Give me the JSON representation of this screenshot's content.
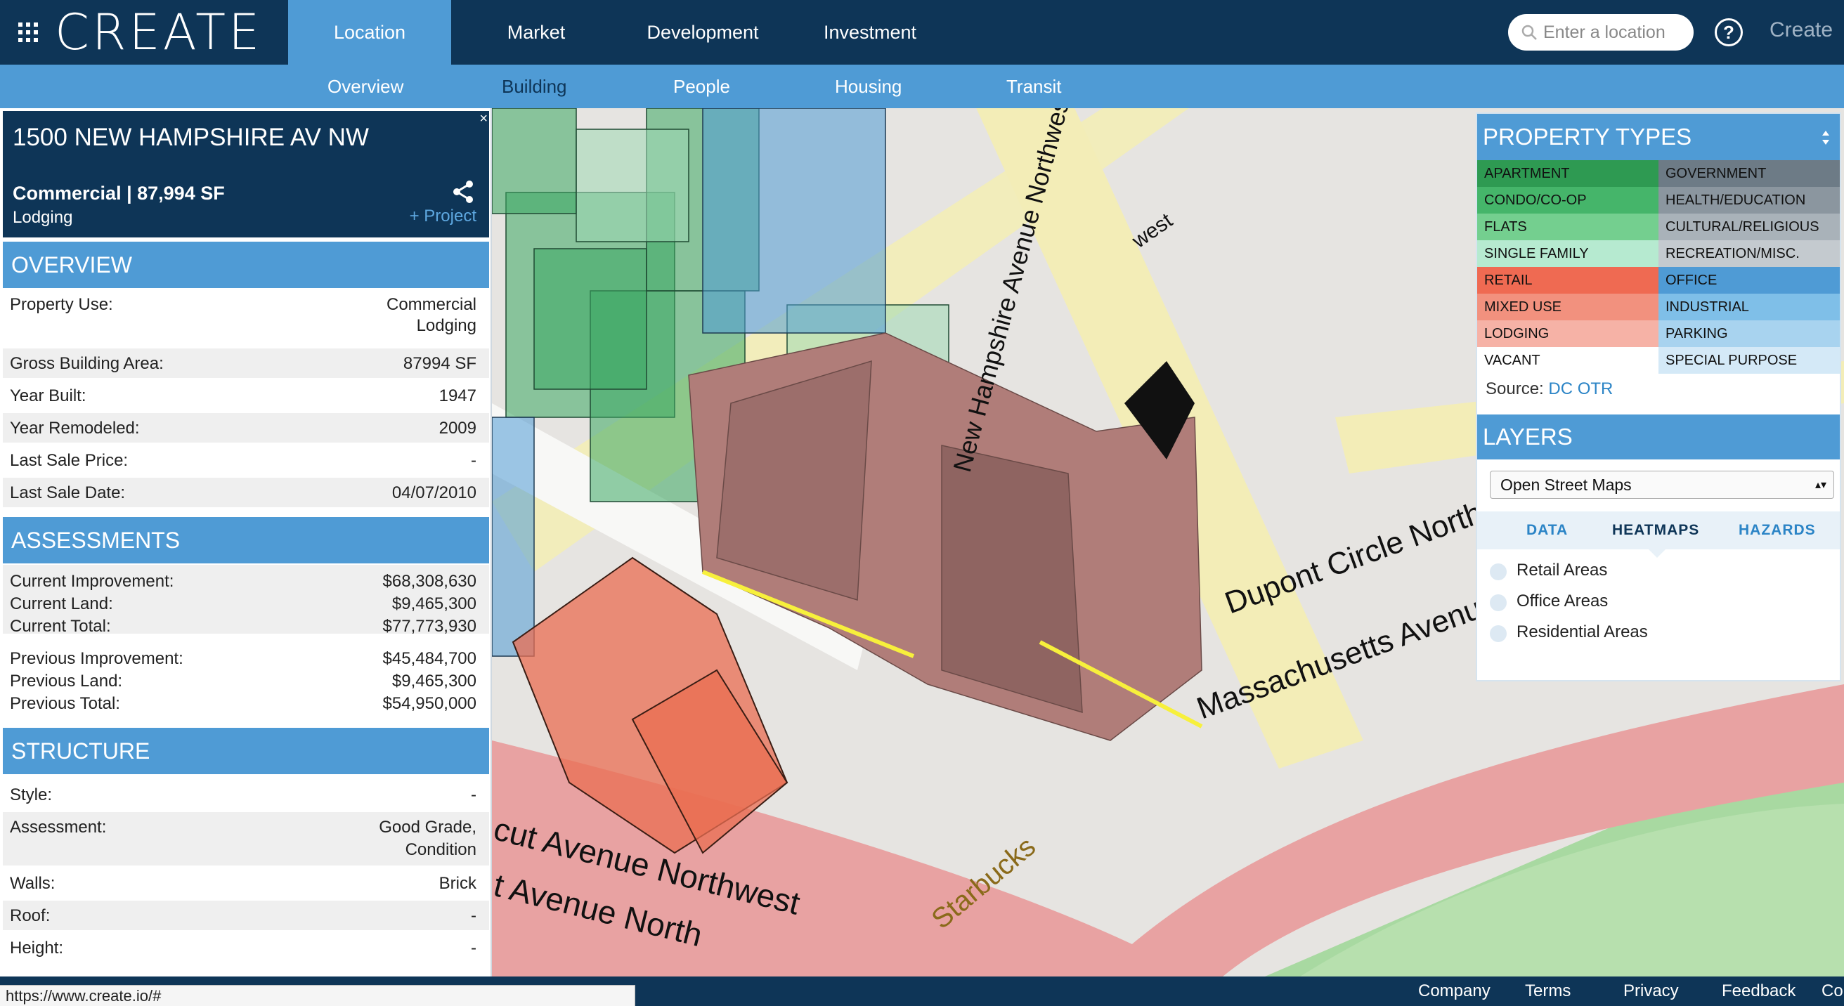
{
  "brand": {
    "name": "CREATE"
  },
  "nav": {
    "tabs": [
      {
        "label": "Location"
      },
      {
        "label": "Market"
      },
      {
        "label": "Development"
      },
      {
        "label": "Investment"
      }
    ],
    "search_placeholder": "Enter a location",
    "help": "?",
    "create": "Create"
  },
  "subnav": {
    "tabs": [
      {
        "label": "Overview"
      },
      {
        "label": "Building"
      },
      {
        "label": "People"
      },
      {
        "label": "Housing"
      },
      {
        "label": "Transit"
      }
    ]
  },
  "property": {
    "address": "1500 NEW HAMPSHIRE AV NW",
    "type_line": "Commercial | 87,994 SF",
    "subtype": "Lodging",
    "project_link": "+ Project",
    "close": "×"
  },
  "overview": {
    "title": "OVERVIEW",
    "rows": [
      {
        "label": "Property Use:",
        "value": "Commercial",
        "value2": "Lodging"
      },
      {
        "label": "Gross Building Area:",
        "value": "87994 SF"
      },
      {
        "label": "Year Built:",
        "value": "1947"
      },
      {
        "label": "Year Remodeled:",
        "value": "2009"
      },
      {
        "label": "Last Sale Price:",
        "value": "-"
      },
      {
        "label": "Last Sale Date:",
        "value": "04/07/2010"
      }
    ]
  },
  "assessments": {
    "title": "ASSESSMENTS",
    "rows": [
      {
        "label": "Current Improvement:",
        "value": "$68,308,630"
      },
      {
        "label": "Current Land:",
        "value": "$9,465,300"
      },
      {
        "label": "Current Total:",
        "value": "$77,773,930"
      },
      {
        "label": "Previous Improvement:",
        "value": "$45,484,700"
      },
      {
        "label": "Previous Land:",
        "value": "$9,465,300"
      },
      {
        "label": "Previous Total:",
        "value": "$54,950,000"
      }
    ]
  },
  "structure": {
    "title": "STRUCTURE",
    "rows": [
      {
        "label": "Style:",
        "value": "-"
      },
      {
        "label": "Assessment:",
        "value": "Good Grade,",
        "value2": "Condition"
      },
      {
        "label": "Walls:",
        "value": "Brick"
      },
      {
        "label": "Roof:",
        "value": "-"
      },
      {
        "label": "Height:",
        "value": "-"
      }
    ]
  },
  "property_types": {
    "title": "PROPERTY TYPES",
    "left": [
      {
        "label": "APARTMENT",
        "color": "#2e9a52"
      },
      {
        "label": "CONDO/CO-OP",
        "color": "#45b56a"
      },
      {
        "label": "FLATS",
        "color": "#74cf8f"
      },
      {
        "label": "SINGLE FAMILY",
        "color": "#b6ead0"
      },
      {
        "label": "RETAIL",
        "color": "#ef6a52"
      },
      {
        "label": "MIXED USE",
        "color": "#f2917e"
      },
      {
        "label": "LODGING",
        "color": "#f6b2a6"
      },
      {
        "label": "VACANT",
        "color": "#ffffff"
      }
    ],
    "right": [
      {
        "label": "GOVERNMENT",
        "color": "#6d7b86"
      },
      {
        "label": "HEALTH/EDUCATION",
        "color": "#8b969f"
      },
      {
        "label": "CULTURAL/RELIGIOUS",
        "color": "#a9b2b9"
      },
      {
        "label": "RECREATION/MISC.",
        "color": "#c4cacf"
      },
      {
        "label": "OFFICE",
        "color": "#4f9bd5"
      },
      {
        "label": "INDUSTRIAL",
        "color": "#7fbfe8"
      },
      {
        "label": "PARKING",
        "color": "#a8d3ef"
      },
      {
        "label": "SPECIAL PURPOSE",
        "color": "#d4e9f7"
      }
    ],
    "source_label": "Source:",
    "source_link": "DC OTR"
  },
  "layers": {
    "title": "LAYERS",
    "basemap": "Open Street Maps",
    "tabs": [
      {
        "label": "DATA"
      },
      {
        "label": "HEATMAPS"
      },
      {
        "label": "HAZARDS"
      }
    ],
    "options": [
      {
        "label": "Retail Areas"
      },
      {
        "label": "Office Areas"
      },
      {
        "label": "Residential Areas"
      }
    ]
  },
  "map_labels": {
    "street1": "Dupont Circle Northwest",
    "street2": "Massachusetts Avenue Northwest",
    "street3": "New Hampshire Avenue Northwest",
    "street4": "cut Avenue Northwest",
    "street5": "t Avenue North",
    "poi": "Starbucks",
    "street6": "west"
  },
  "footer": {
    "links": [
      {
        "label": "Company"
      },
      {
        "label": "Terms"
      },
      {
        "label": "Privacy"
      },
      {
        "label": "Feedback"
      },
      {
        "label": "Co"
      }
    ],
    "status_url": "https://www.create.io/#"
  }
}
